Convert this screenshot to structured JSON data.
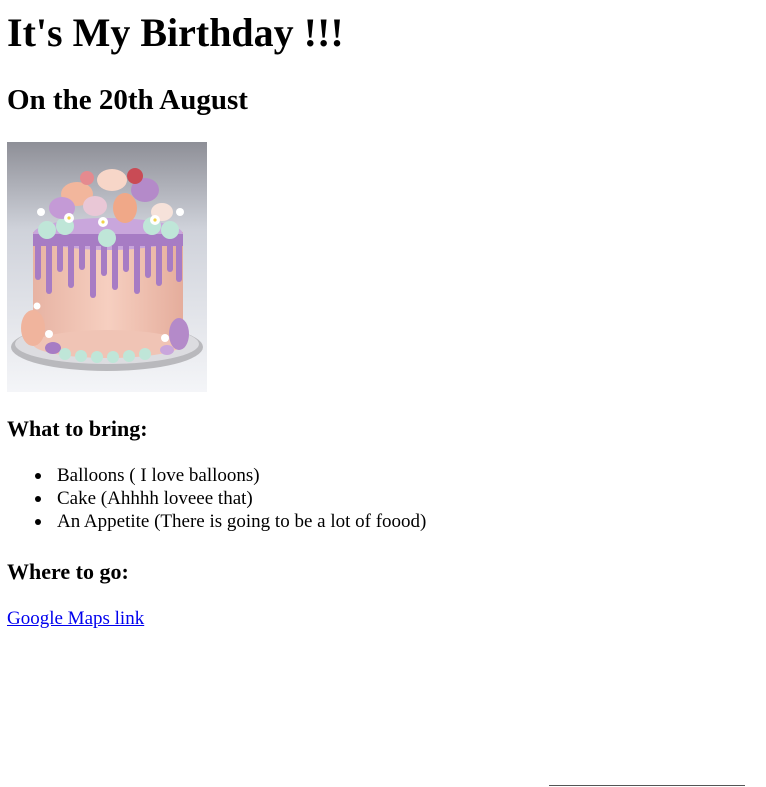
{
  "header": {
    "title": "It's My Birthday !!!",
    "subtitle": "On the 20th August"
  },
  "image": {
    "alt": "cake",
    "palette": {
      "background": "#d9dde3",
      "frosting": "#f1c6b8",
      "drip": "#a77cc4",
      "mint": "#bfe6d8",
      "plate": "#c9c9cc"
    }
  },
  "bring": {
    "heading": "What to bring:",
    "items": [
      "Balloons ( I love balloons)",
      "Cake (Ahhhh loveee that)",
      "An Appetite (There is going to be a lot of foood)"
    ]
  },
  "where": {
    "heading": "Where to go:",
    "link_text": "Google Maps link"
  },
  "colors": {
    "link": "#0000ee",
    "text": "#000000"
  }
}
